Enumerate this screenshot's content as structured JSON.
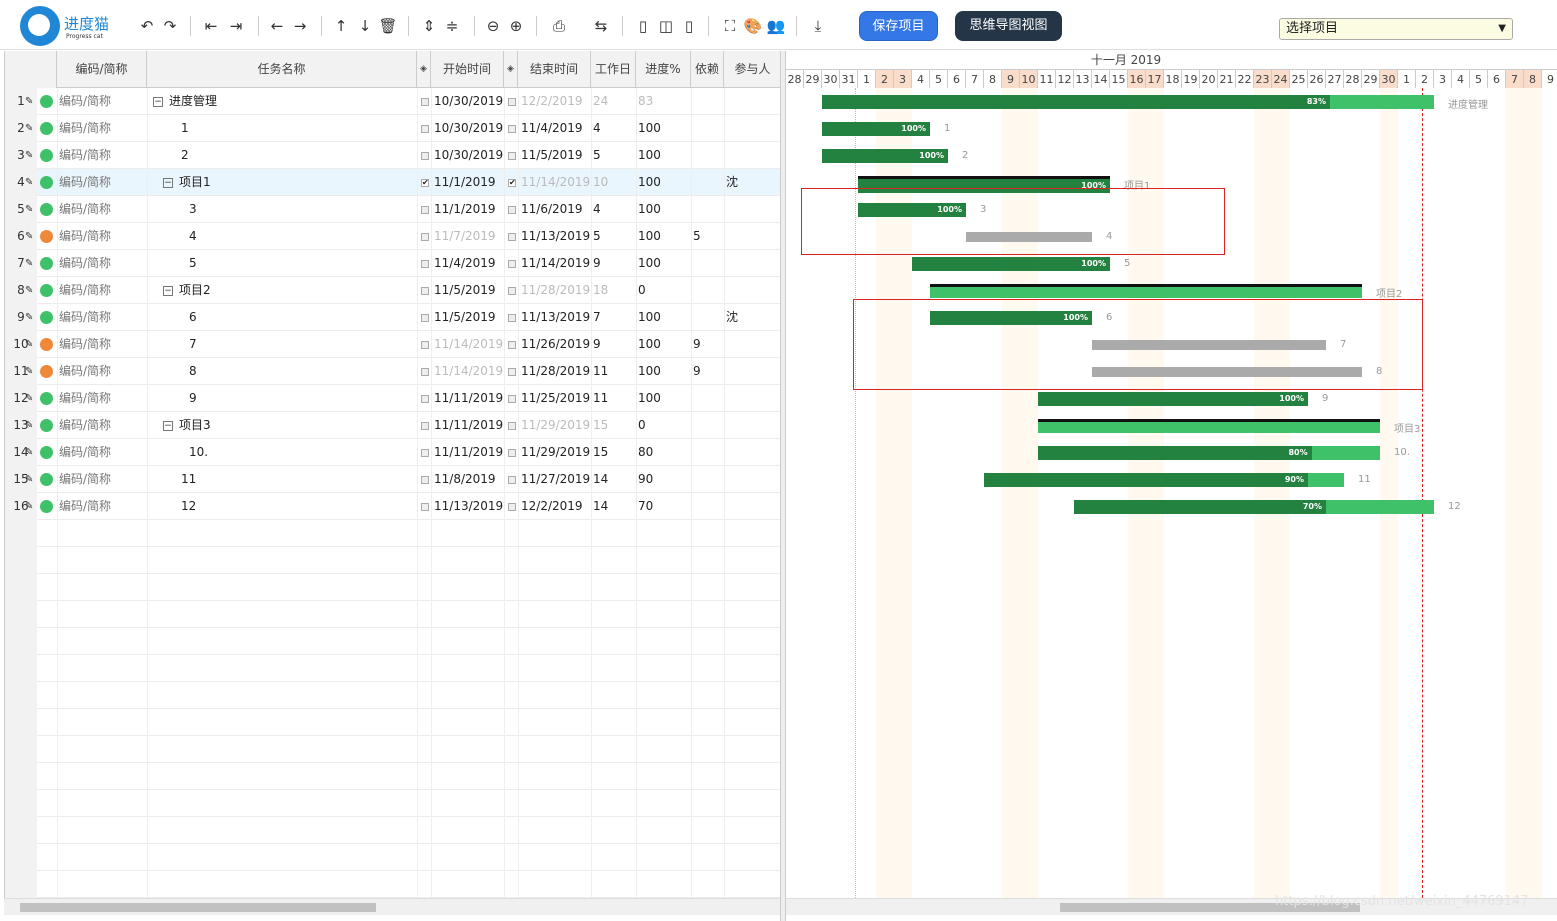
{
  "toolbar": {
    "logo_name": "进度猫",
    "logo_sub": "Progress cat",
    "save_label": "保存项目",
    "mind_label": "思维导图视图",
    "project_select": "选择项目"
  },
  "grid": {
    "headers": [
      "编码/简称",
      "任务名称",
      "开始时间",
      "结束时间",
      "工作日",
      "进度%",
      "依赖",
      "参与人"
    ],
    "rows": [
      {
        "num": "1",
        "code": "编码/简称",
        "status": "green",
        "name": "进度管理",
        "level": 0,
        "group": true,
        "start": "10/30/2019",
        "end": "12/2/2019",
        "days": "24",
        "progress": "83",
        "dep": "",
        "person": "",
        "end_checked": false,
        "start_muted": false,
        "end_muted": true,
        "days_muted": true,
        "prog_muted": true
      },
      {
        "num": "2",
        "code": "编码/简称",
        "status": "green",
        "name": "1",
        "level": 1,
        "group": false,
        "start": "10/30/2019",
        "end": "11/4/2019",
        "days": "4",
        "progress": "100",
        "dep": "",
        "person": "",
        "end_checked": false,
        "start_muted": false,
        "end_muted": false,
        "days_muted": false,
        "prog_muted": false
      },
      {
        "num": "3",
        "code": "编码/简称",
        "status": "green",
        "name": "2",
        "level": 1,
        "group": false,
        "start": "10/30/2019",
        "end": "11/5/2019",
        "days": "5",
        "progress": "100",
        "dep": "",
        "person": "",
        "end_checked": false,
        "start_muted": false,
        "end_muted": false,
        "days_muted": false,
        "prog_muted": false
      },
      {
        "num": "4",
        "code": "编码/简称",
        "status": "green",
        "name": "项目1",
        "level": 1,
        "group": true,
        "start": "11/1/2019",
        "end": "11/14/2019",
        "days": "10",
        "progress": "100",
        "dep": "",
        "person": "沈",
        "end_checked": true,
        "start_checked": true,
        "start_muted": false,
        "end_muted": true,
        "days_muted": true,
        "prog_muted": false,
        "selected": true
      },
      {
        "num": "5",
        "code": "编码/简称",
        "status": "green",
        "name": "3",
        "level": 2,
        "group": false,
        "start": "11/1/2019",
        "end": "11/6/2019",
        "days": "4",
        "progress": "100",
        "dep": "",
        "person": "",
        "end_checked": false,
        "start_muted": false,
        "end_muted": false,
        "days_muted": false,
        "prog_muted": false
      },
      {
        "num": "6",
        "code": "编码/简称",
        "status": "orange",
        "name": "4",
        "level": 2,
        "group": false,
        "start": "11/7/2019",
        "end": "11/13/2019",
        "days": "5",
        "progress": "100",
        "dep": "5",
        "person": "",
        "end_checked": false,
        "start_muted": true,
        "end_muted": false,
        "days_muted": false,
        "prog_muted": false
      },
      {
        "num": "7",
        "code": "编码/简称",
        "status": "green",
        "name": "5",
        "level": 2,
        "group": false,
        "start": "11/4/2019",
        "end": "11/14/2019",
        "days": "9",
        "progress": "100",
        "dep": "",
        "person": "",
        "end_checked": false,
        "start_muted": false,
        "end_muted": false,
        "days_muted": false,
        "prog_muted": false
      },
      {
        "num": "8",
        "code": "编码/简称",
        "status": "green",
        "name": "项目2",
        "level": 1,
        "group": true,
        "start": "11/5/2019",
        "end": "11/28/2019",
        "days": "18",
        "progress": "0",
        "dep": "",
        "person": "",
        "end_checked": false,
        "start_muted": false,
        "end_muted": true,
        "days_muted": true,
        "prog_muted": false
      },
      {
        "num": "9",
        "code": "编码/简称",
        "status": "green",
        "name": "6",
        "level": 2,
        "group": false,
        "start": "11/5/2019",
        "end": "11/13/2019",
        "days": "7",
        "progress": "100",
        "dep": "",
        "person": "沈",
        "end_checked": false,
        "start_muted": false,
        "end_muted": false,
        "days_muted": false,
        "prog_muted": false
      },
      {
        "num": "10",
        "code": "编码/简称",
        "status": "orange",
        "name": "7",
        "level": 2,
        "group": false,
        "start": "11/14/2019",
        "end": "11/26/2019",
        "days": "9",
        "progress": "100",
        "dep": "9",
        "person": "",
        "end_checked": false,
        "start_muted": true,
        "end_muted": false,
        "days_muted": false,
        "prog_muted": false
      },
      {
        "num": "11",
        "code": "编码/简称",
        "status": "orange",
        "name": "8",
        "level": 2,
        "group": false,
        "start": "11/14/2019",
        "end": "11/28/2019",
        "days": "11",
        "progress": "100",
        "dep": "9",
        "person": "",
        "end_checked": false,
        "start_muted": true,
        "end_muted": false,
        "days_muted": false,
        "prog_muted": false
      },
      {
        "num": "12",
        "code": "编码/简称",
        "status": "green",
        "name": "9",
        "level": 2,
        "group": false,
        "start": "11/11/2019",
        "end": "11/25/2019",
        "days": "11",
        "progress": "100",
        "dep": "",
        "person": "",
        "end_checked": false,
        "start_muted": false,
        "end_muted": false,
        "days_muted": false,
        "prog_muted": false
      },
      {
        "num": "13",
        "code": "编码/简称",
        "status": "green",
        "name": "项目3",
        "level": 1,
        "group": true,
        "start": "11/11/2019",
        "end": "11/29/2019",
        "days": "15",
        "progress": "0",
        "dep": "",
        "person": "",
        "end_checked": false,
        "start_muted": false,
        "end_muted": true,
        "days_muted": true,
        "prog_muted": false
      },
      {
        "num": "14",
        "code": "编码/简称",
        "status": "green",
        "name": "10.",
        "level": 2,
        "group": false,
        "start": "11/11/2019",
        "end": "11/29/2019",
        "days": "15",
        "progress": "80",
        "dep": "",
        "person": "",
        "end_checked": false,
        "start_muted": false,
        "end_muted": false,
        "days_muted": false,
        "prog_muted": false
      },
      {
        "num": "15",
        "code": "编码/简称",
        "status": "green",
        "name": "11",
        "level": 1,
        "group": false,
        "start": "11/8/2019",
        "end": "11/27/2019",
        "days": "14",
        "progress": "90",
        "dep": "",
        "person": "",
        "end_checked": false,
        "start_muted": false,
        "end_muted": false,
        "days_muted": false,
        "prog_muted": false
      },
      {
        "num": "16",
        "code": "编码/简称",
        "status": "green",
        "name": "12",
        "level": 1,
        "group": false,
        "start": "11/13/2019",
        "end": "12/2/2019",
        "days": "14",
        "progress": "70",
        "dep": "",
        "person": "",
        "end_checked": false,
        "start_muted": false,
        "end_muted": false,
        "days_muted": false,
        "prog_muted": false
      }
    ]
  },
  "gantt": {
    "month_label": "十一月 2019",
    "days": [
      "28",
      "29",
      "30",
      "31",
      "1",
      "2",
      "3",
      "4",
      "5",
      "6",
      "7",
      "8",
      "9",
      "10",
      "11",
      "12",
      "13",
      "14",
      "15",
      "16",
      "17",
      "18",
      "19",
      "20",
      "21",
      "22",
      "23",
      "24",
      "25",
      "26",
      "27",
      "28",
      "29",
      "30",
      "1",
      "2",
      "3",
      "4",
      "5",
      "6",
      "7",
      "8",
      "9"
    ],
    "weekend_index": [
      5,
      6,
      12,
      13,
      19,
      20,
      26,
      27,
      33,
      40,
      41
    ],
    "bars": [
      {
        "row": 0,
        "start": 2,
        "end": 36,
        "progress": 83,
        "label": "83%",
        "tail": "进度管理",
        "summary": false
      },
      {
        "row": 1,
        "start": 2,
        "end": 8,
        "progress": 100,
        "label": "100%",
        "tail": "1"
      },
      {
        "row": 2,
        "start": 2,
        "end": 9,
        "progress": 100,
        "label": "100%",
        "tail": "2"
      },
      {
        "row": 3,
        "start": 4,
        "end": 18,
        "progress": 100,
        "label": "100%",
        "tail": "项目1",
        "milestone": true
      },
      {
        "row": 4,
        "start": 4,
        "end": 10,
        "progress": 100,
        "label": "100%",
        "tail": "3"
      },
      {
        "row": 5,
        "start": 10,
        "end": 17,
        "progress": 0,
        "label": "",
        "tail": "4",
        "gray": true
      },
      {
        "row": 6,
        "start": 7,
        "end": 18,
        "progress": 100,
        "label": "100%",
        "tail": "5"
      },
      {
        "row": 7,
        "start": 8,
        "end": 32,
        "progress": 0,
        "label": "",
        "tail": "项目2",
        "summary": true
      },
      {
        "row": 8,
        "start": 8,
        "end": 17,
        "progress": 100,
        "label": "100%",
        "tail": "6"
      },
      {
        "row": 9,
        "start": 17,
        "end": 30,
        "progress": 0,
        "label": "",
        "tail": "7",
        "gray": true
      },
      {
        "row": 10,
        "start": 17,
        "end": 32,
        "progress": 0,
        "label": "",
        "tail": "8",
        "gray": true
      },
      {
        "row": 11,
        "start": 14,
        "end": 29,
        "progress": 100,
        "label": "100%",
        "tail": "9"
      },
      {
        "row": 12,
        "start": 14,
        "end": 33,
        "progress": 0,
        "label": "",
        "tail": "项目3",
        "summary": true
      },
      {
        "row": 13,
        "start": 14,
        "end": 33,
        "progress": 80,
        "label": "80%",
        "tail": "10."
      },
      {
        "row": 14,
        "start": 11,
        "end": 31,
        "progress": 90,
        "label": "90%",
        "tail": "11"
      },
      {
        "row": 15,
        "start": 16,
        "end": 36,
        "progress": 70,
        "label": "70%",
        "tail": "12"
      }
    ]
  },
  "watermark": "https://blog.csdn.net/weixin_44769147",
  "colors": {
    "green": "#3fc16a",
    "dark_green": "#23823f",
    "orange": "#f0883a",
    "accent": "#3478e8"
  }
}
